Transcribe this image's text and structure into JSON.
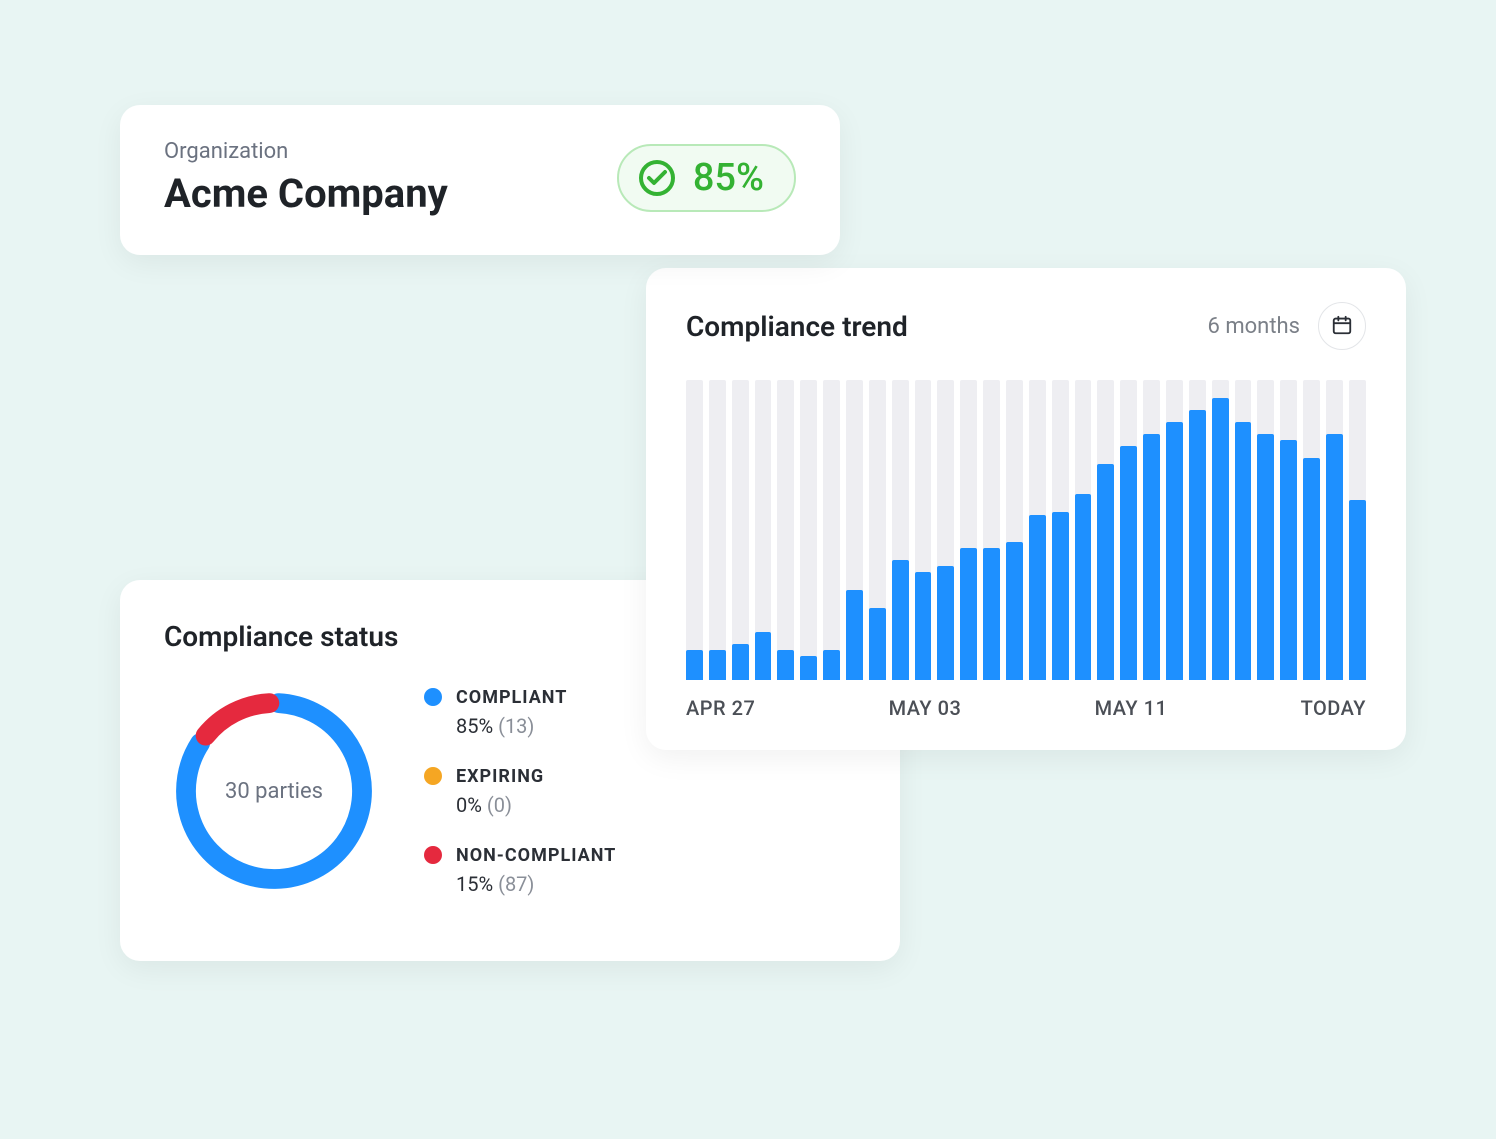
{
  "org": {
    "label": "Organization",
    "name": "Acme Company",
    "score": "85%"
  },
  "trend": {
    "title": "Compliance trend",
    "range_label": "6 months",
    "x_ticks": [
      "APR 27",
      "MAY 03",
      "MAY 11",
      "TODAY"
    ]
  },
  "status": {
    "title": "Compliance status",
    "center_label": "30 parties",
    "items": [
      {
        "name": "COMPLIANT",
        "pct": "85%",
        "count": "(13)",
        "color": "#1e90ff"
      },
      {
        "name": "EXPIRING",
        "pct": "0%",
        "count": "(0)",
        "color": "#f5a623"
      },
      {
        "name": "NON-COMPLIANT",
        "pct": "15%",
        "count": "(87)",
        "color": "#e5293e"
      }
    ]
  },
  "chart_data": [
    {
      "type": "bar",
      "title": "Compliance trend",
      "xlabel": "",
      "ylabel": "",
      "ylim": [
        0,
        100
      ],
      "categories_note": "daily bars spanning roughly Apr 27 → today; ticks shown at APR 27, MAY 03, MAY 11, TODAY",
      "x_ticks": [
        "APR 27",
        "MAY 03",
        "MAY 11",
        "TODAY"
      ],
      "values": [
        10,
        10,
        12,
        16,
        10,
        8,
        10,
        30,
        24,
        40,
        36,
        38,
        44,
        44,
        46,
        55,
        56,
        62,
        72,
        78,
        82,
        86,
        90,
        94,
        86,
        82,
        80,
        74,
        82,
        60
      ]
    },
    {
      "type": "pie",
      "title": "Compliance status",
      "center": "30 parties",
      "series": [
        {
          "name": "COMPLIANT",
          "value": 85,
          "count": 13,
          "color": "#1e90ff"
        },
        {
          "name": "EXPIRING",
          "value": 0,
          "count": 0,
          "color": "#f5a623"
        },
        {
          "name": "NON-COMPLIANT",
          "value": 15,
          "count": 87,
          "color": "#e5293e"
        }
      ]
    }
  ]
}
